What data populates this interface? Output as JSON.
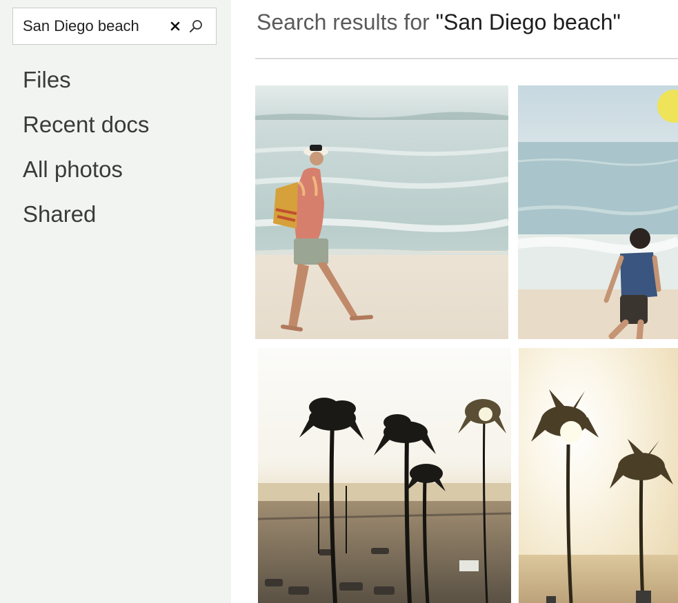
{
  "search": {
    "value": "San Diego beach",
    "clear_icon": "close-icon",
    "search_icon": "search-icon"
  },
  "nav": {
    "items": [
      {
        "label": "Files"
      },
      {
        "label": "Recent docs"
      },
      {
        "label": "All photos"
      },
      {
        "label": "Shared"
      }
    ]
  },
  "main": {
    "title_prefix": "Search results for ",
    "title_query": "\"San Diego beach\""
  },
  "colors": {
    "sidebar_bg": "#f2f4f2",
    "divider": "#dadada"
  },
  "photos": [
    {
      "subject": "woman walking on beach"
    },
    {
      "subject": "child running on beach"
    },
    {
      "subject": "palm trees at sunset"
    },
    {
      "subject": "palm trees in sun"
    }
  ]
}
